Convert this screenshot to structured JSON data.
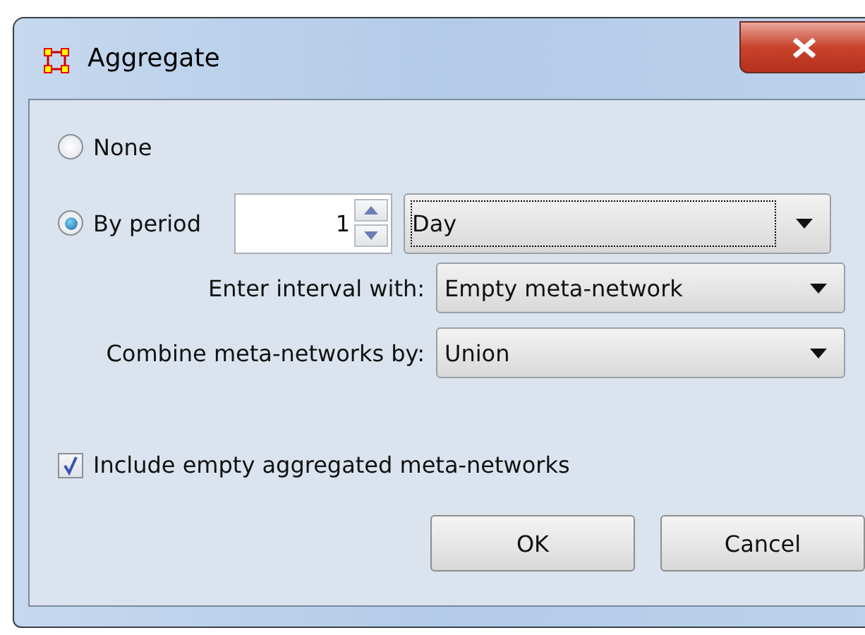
{
  "window": {
    "title": "Aggregate"
  },
  "options": [
    {
      "label": "None",
      "selected": false
    },
    {
      "label": "By period",
      "selected": true
    }
  ],
  "period": {
    "value": "1",
    "unit": "Day",
    "focused": true
  },
  "fields": [
    {
      "label": "Enter interval with:",
      "value": "Empty meta-network"
    },
    {
      "label": "Combine meta-networks by:",
      "value": "Union"
    }
  ],
  "include_empty": {
    "label": "Include empty aggregated meta-networks",
    "checked": true
  },
  "buttons": [
    "OK",
    "Cancel"
  ]
}
